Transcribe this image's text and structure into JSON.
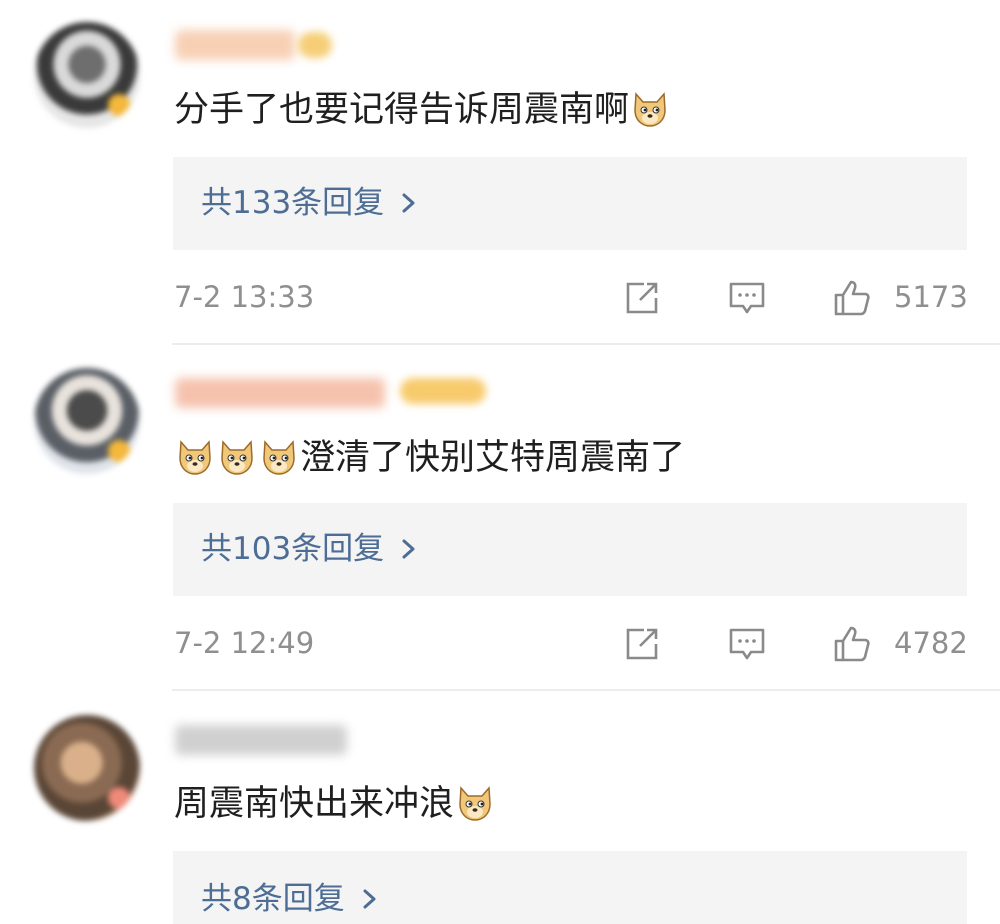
{
  "colors": {
    "reply_link": "#4d6d95",
    "meta_text": "#8f8f8f",
    "reply_bg": "#f4f4f4",
    "divider": "#ececec",
    "vip_badge": "#f3b83c"
  },
  "comments": [
    {
      "text": "分手了也要记得告诉周震南啊",
      "emoji_before": 0,
      "emoji_after": 1,
      "emoji_icon": "doge-emoji-icon",
      "reply_label": "共133条回复",
      "time": "7-2 13:33",
      "likes": "5173"
    },
    {
      "text": "澄清了快别艾特周震南了",
      "emoji_before": 3,
      "emoji_after": 0,
      "emoji_icon": "doge-emoji-icon",
      "reply_label": "共103条回复",
      "time": "7-2 12:49",
      "likes": "4782"
    },
    {
      "text": "周震南快出来冲浪",
      "emoji_before": 0,
      "emoji_after": 1,
      "emoji_icon": "doge-emoji-icon",
      "reply_label": "共8条回复"
    }
  ],
  "icons": {
    "share": "share-icon",
    "reply": "comment-icon",
    "like": "thumbs-up-icon",
    "chevron": "chevron-right-icon"
  }
}
